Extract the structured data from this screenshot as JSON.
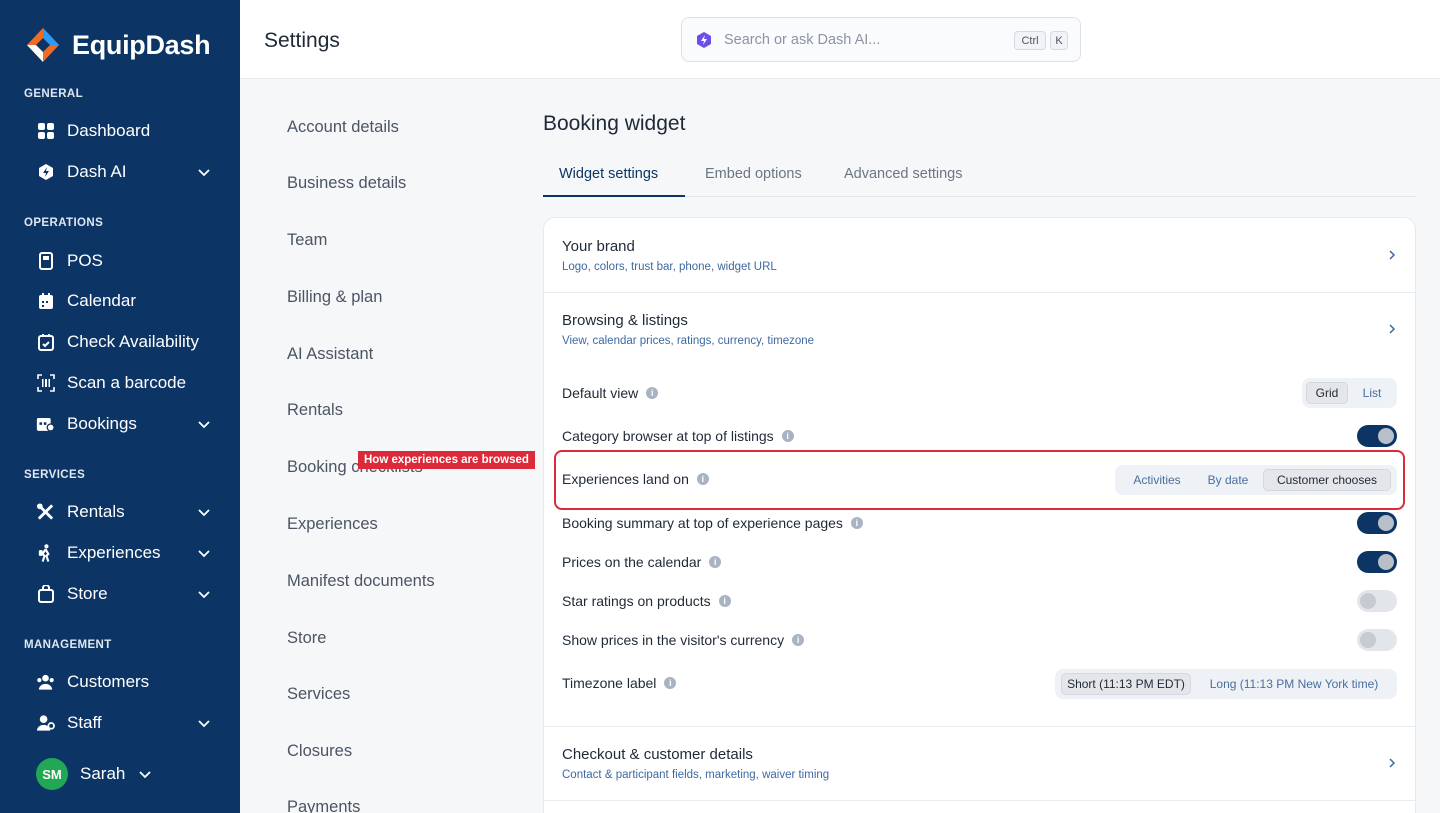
{
  "brand": {
    "name": "EquipDash"
  },
  "sidebar": {
    "sections": {
      "general": "GENERAL",
      "operations": "OPERATIONS",
      "services": "SERVICES",
      "management": "MANAGEMENT"
    },
    "items": {
      "dashboard": "Dashboard",
      "dash_ai": "Dash AI",
      "pos": "POS",
      "calendar": "Calendar",
      "check_availability": "Check Availability",
      "scan_barcode": "Scan a barcode",
      "bookings": "Bookings",
      "rentals": "Rentals",
      "experiences": "Experiences",
      "store": "Store",
      "customers": "Customers",
      "staff": "Staff"
    },
    "user": {
      "initials": "SM",
      "name": "Sarah"
    }
  },
  "header": {
    "title": "Settings",
    "search_placeholder": "Search or ask Dash AI...",
    "shortcut": [
      "Ctrl",
      "K"
    ]
  },
  "settings_nav": [
    "Account details",
    "Business details",
    "Team",
    "Billing & plan",
    "AI Assistant",
    "Rentals",
    "Booking checklists",
    "Experiences",
    "Manifest documents",
    "Store",
    "Services",
    "Closures",
    "Payments"
  ],
  "main": {
    "title": "Booking widget",
    "tabs": [
      "Widget settings",
      "Embed options",
      "Advanced settings"
    ],
    "active_tab": "Widget settings",
    "sections": {
      "brand": {
        "title": "Your brand",
        "subtitle": "Logo, colors, trust bar, phone, widget URL"
      },
      "browsing": {
        "title": "Browsing & listings",
        "subtitle": "View, calendar prices, ratings, currency, timezone"
      },
      "checkout": {
        "title": "Checkout & customer details",
        "subtitle": "Contact & participant fields, marketing, waiver timing"
      }
    },
    "settings": {
      "default_view": {
        "label": "Default view",
        "options": [
          "Grid",
          "List"
        ],
        "selected": "Grid"
      },
      "category_browser": {
        "label": "Category browser at top of listings",
        "on": true
      },
      "experiences_land_on": {
        "label": "Experiences land on",
        "options": [
          "Activities",
          "By date",
          "Customer chooses"
        ],
        "selected": "Customer chooses"
      },
      "booking_summary": {
        "label": "Booking summary at top of experience pages",
        "on": true
      },
      "prices_calendar": {
        "label": "Prices on the calendar",
        "on": true
      },
      "star_ratings": {
        "label": "Star ratings on products",
        "on": false
      },
      "visitor_currency": {
        "label": "Show prices in the visitor's currency",
        "on": false
      },
      "timezone_label": {
        "label": "Timezone label",
        "options": [
          "Short (11:13 PM EDT)",
          "Long (11:13 PM New York time)"
        ],
        "selected": "Short (11:13 PM EDT)"
      }
    }
  },
  "annotation": {
    "label": "How experiences are browsed",
    "color": "#dc2a3a"
  },
  "colors": {
    "sidebar": "#0c3565",
    "accent": "#0c3565",
    "avatar": "#22a755"
  }
}
